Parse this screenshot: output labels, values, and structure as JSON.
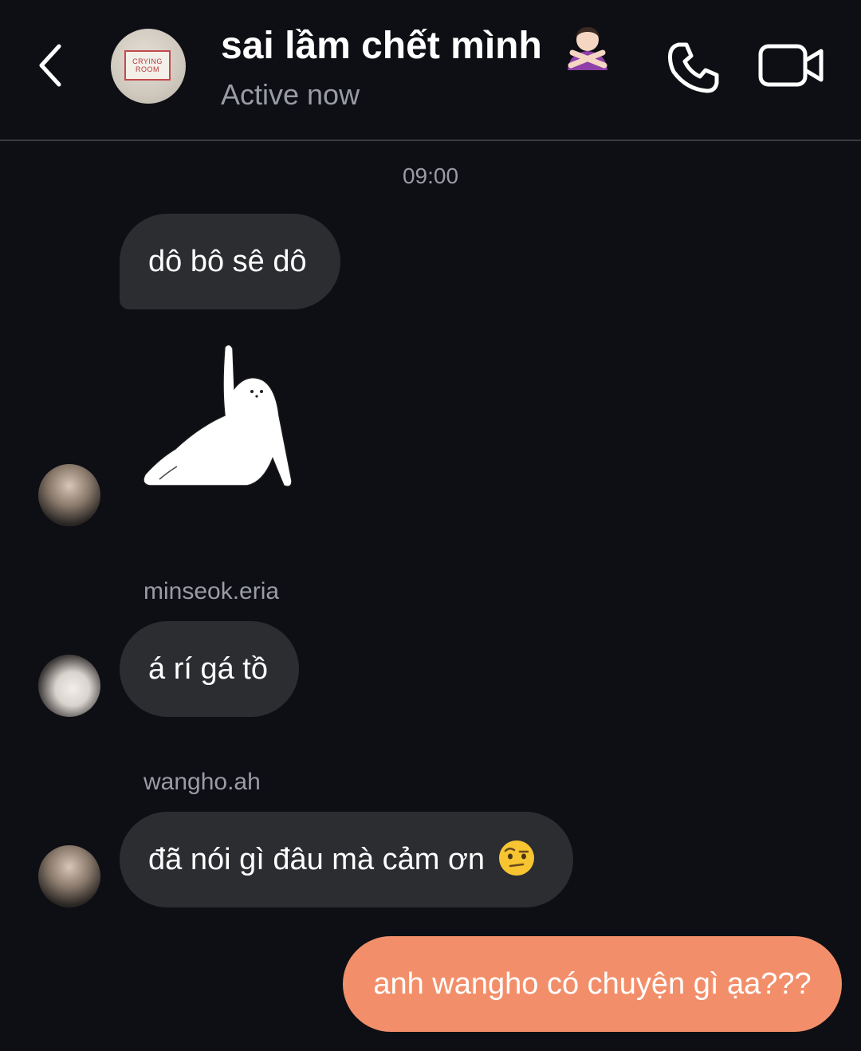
{
  "header": {
    "title": "sai lầm chết mình",
    "title_emoji": "person-gesturing-no-emoji",
    "status": "Active now",
    "group_avatar_text_line1": "CRYING",
    "group_avatar_text_line2": "ROOM"
  },
  "icons": {
    "back": "chevron-left-icon",
    "call": "phone-icon",
    "video": "video-camera-icon"
  },
  "timestamp": "09:00",
  "messages": [
    {
      "type": "text",
      "direction": "incoming",
      "text": "dô bô sê dô"
    },
    {
      "type": "sticker",
      "direction": "incoming",
      "sticker": "white-seal-raising-flipper"
    },
    {
      "type": "text",
      "direction": "incoming",
      "sender": "minseok.eria",
      "text": "á rí gá tồ"
    },
    {
      "type": "text",
      "direction": "incoming",
      "sender": "wangho.ah",
      "text": "đã nói gì đâu mà cảm ơn",
      "emoji": "face-with-raised-eyebrow-emoji"
    },
    {
      "type": "text",
      "direction": "outgoing",
      "text": "anh wangho có chuyện gì ạa???"
    }
  ],
  "colors": {
    "background": "#0e0f14",
    "incoming_bubble": "#2b2d31",
    "outgoing_bubble": "#f28f6a",
    "secondary_text": "#9a9ca4"
  }
}
